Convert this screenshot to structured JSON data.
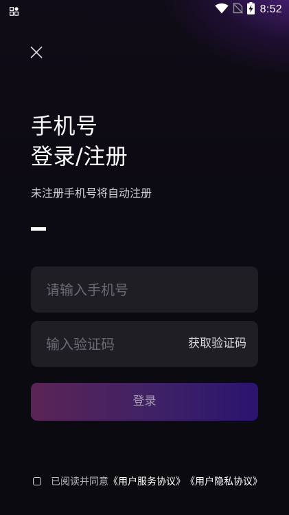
{
  "status_bar": {
    "time": "8:52",
    "battery_icon": "battery-charging-icon",
    "wifi_icon": "wifi-icon",
    "signal_icon": "no-sim-icon",
    "app_icon": "notification-grid-icon"
  },
  "close_icon": "close-icon",
  "title": {
    "line1": "手机号",
    "line2": "登录/注册"
  },
  "subtitle": "未注册手机号将自动注册",
  "phone_field": {
    "value": "",
    "placeholder": "请输入手机号"
  },
  "code_field": {
    "value": "",
    "placeholder": "输入验证码",
    "get_code_label": "获取验证码"
  },
  "login_button": {
    "label": "登录"
  },
  "agreement": {
    "checked": false,
    "prefix": "已阅读并同意",
    "user_service_link": "《用户服务协议》",
    "privacy_link": "《用户隐私协议》"
  },
  "colors": {
    "background": "#0b0910",
    "accent_glow": "#62289f",
    "field_background": "#1f1e24",
    "login_gradient_start": "#5a2555",
    "login_gradient_end": "#2b1470",
    "placeholder": "#6b6a72"
  }
}
